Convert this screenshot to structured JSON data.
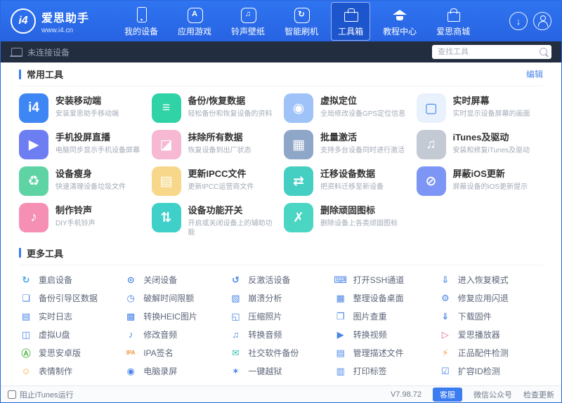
{
  "header": {
    "logo_text": "i4",
    "brand": "爱思助手",
    "website": "www.i4.cn",
    "nav": [
      {
        "label": "我的设备",
        "icon": "phone"
      },
      {
        "label": "应用游戏",
        "icon": "apps"
      },
      {
        "label": "铃声壁纸",
        "icon": "ringtone"
      },
      {
        "label": "智能刷机",
        "icon": "flash"
      },
      {
        "label": "工具箱",
        "icon": "toolbox",
        "active": true
      },
      {
        "label": "教程中心",
        "icon": "tutorial"
      },
      {
        "label": "爱思商城",
        "icon": "mall"
      }
    ]
  },
  "device_bar": {
    "status": "未连接设备",
    "search_placeholder": "查找工具"
  },
  "common_tools": {
    "title": "常用工具",
    "edit": "编辑",
    "cards": [
      {
        "title": "安装移动端",
        "subtitle": "安装爱思助手移动端",
        "icon": "i4-mobile",
        "glyph": "i4",
        "bg": "#3f86f5",
        "fg": "#ffffff"
      },
      {
        "title": "备份/恢复数据",
        "subtitle": "轻松备份和恢复设备的资料",
        "icon": "backup-restore",
        "glyph": "≡",
        "bg": "#2fd3a6",
        "fg": "#ffffff"
      },
      {
        "title": "虚拟定位",
        "subtitle": "全局修改设备GPS定位信息",
        "icon": "virtual-location",
        "glyph": "◉",
        "bg": "#9fc3f8",
        "fg": "#ffffff"
      },
      {
        "title": "实时屏幕",
        "subtitle": "实时显示设备屏幕的画面",
        "icon": "live-screen",
        "glyph": "▢",
        "bg": "#e9f1fd",
        "fg": "#3f86f5"
      },
      {
        "title": "手机投屏直播",
        "subtitle": "电脑同步显示手机设备屏幕",
        "icon": "screen-mirroring",
        "glyph": "▶",
        "bg": "#6d7ef2",
        "fg": "#ffffff"
      },
      {
        "title": "抹除所有数据",
        "subtitle": "恢复设备到出厂状态",
        "icon": "erase-all-data",
        "glyph": "◪",
        "bg": "#f6b8d2",
        "fg": "#ffffff"
      },
      {
        "title": "批量激活",
        "subtitle": "支持多台设备同时进行激活",
        "icon": "batch-activation",
        "glyph": "▦",
        "bg": "#8ea6c8",
        "fg": "#ffffff"
      },
      {
        "title": "iTunes及驱动",
        "subtitle": "安装和修复iTunes及驱动",
        "icon": "itunes-driver",
        "glyph": "♫",
        "bg": "#c3cad4",
        "fg": "#ffffff"
      },
      {
        "title": "设备瘦身",
        "subtitle": "快速清理设备垃圾文件",
        "icon": "device-cleanup",
        "glyph": "♻",
        "bg": "#5ed3a4",
        "fg": "#ffffff"
      },
      {
        "title": "更新IPCC文件",
        "subtitle": "更新IPCC运营商文件",
        "icon": "ipcc-update",
        "glyph": "▤",
        "bg": "#f7d88b",
        "fg": "#ffffff"
      },
      {
        "title": "迁移设备数据",
        "subtitle": "把资料迁移至新设备",
        "icon": "migrate-device-data",
        "glyph": "⇄",
        "bg": "#45cfc3",
        "fg": "#ffffff"
      },
      {
        "title": "屏蔽iOS更新",
        "subtitle": "屏蔽设备的iOS更新提示",
        "icon": "block-ios-update",
        "glyph": "⊘",
        "bg": "#7d96f5",
        "fg": "#ffffff"
      },
      {
        "title": "制作铃声",
        "subtitle": "DIY手机铃声",
        "icon": "ringtone-maker",
        "glyph": "♪",
        "bg": "#f590b4",
        "fg": "#ffffff"
      },
      {
        "title": "设备功能开关",
        "subtitle": "开启或关闭设备上的辅助功能",
        "icon": "device-switches",
        "glyph": "⇅",
        "bg": "#3fd0c9",
        "fg": "#ffffff"
      },
      {
        "title": "删除顽固图标",
        "subtitle": "删除设备上各类顽固图标",
        "icon": "delete-stubborn-icons",
        "glyph": "✗",
        "bg": "#4ad6c2",
        "fg": "#ffffff"
      }
    ]
  },
  "more_tools": {
    "title": "更多工具",
    "items": [
      {
        "label": "重启设备",
        "icon": "restart-device",
        "glyph": "↻",
        "color": "#49a6e8"
      },
      {
        "label": "关闭设备",
        "icon": "shutdown-device",
        "glyph": "⊙",
        "color": "#4a86e8"
      },
      {
        "label": "反激活设备",
        "icon": "deactivate-device",
        "glyph": "↺",
        "color": "#4a86e8"
      },
      {
        "label": "打开SSH通道",
        "icon": "ssh-tunnel",
        "glyph": "⌨",
        "color": "#4a86e8"
      },
      {
        "label": "进入恢复模式",
        "icon": "recovery-mode",
        "glyph": "⇩",
        "color": "#4a86e8"
      },
      {
        "label": "备份引导区数据",
        "icon": "backup-boot-data",
        "glyph": "❏",
        "color": "#4a86e8"
      },
      {
        "label": "破解时间限额",
        "icon": "crack-screen-time",
        "glyph": "◷",
        "color": "#4a86e8"
      },
      {
        "label": "崩溃分析",
        "icon": "crash-analysis",
        "glyph": "▧",
        "color": "#4a86e8"
      },
      {
        "label": "整理设备桌面",
        "icon": "arrange-desktop",
        "glyph": "▦",
        "color": "#4a86e8"
      },
      {
        "label": "修复应用闪退",
        "icon": "fix-app-crash",
        "glyph": "⚙",
        "color": "#4a86e8"
      },
      {
        "label": "实时日志",
        "icon": "realtime-log",
        "glyph": "▤",
        "color": "#4a86e8"
      },
      {
        "label": "转换HEIC图片",
        "icon": "heic-converter",
        "glyph": "▩",
        "color": "#4a86e8"
      },
      {
        "label": "压缩照片",
        "icon": "compress-photos",
        "glyph": "◱",
        "color": "#4a86e8"
      },
      {
        "label": "图片查重",
        "icon": "duplicate-photo-finder",
        "glyph": "❐",
        "color": "#4a86e8"
      },
      {
        "label": "下载固件",
        "icon": "download-firmware",
        "glyph": "⇓",
        "color": "#4a86e8"
      },
      {
        "label": "虚拟U盘",
        "icon": "virtual-usb-disk",
        "glyph": "◫",
        "color": "#4a86e8"
      },
      {
        "label": "修改音频",
        "icon": "edit-audio",
        "glyph": "♪",
        "color": "#4a86e8"
      },
      {
        "label": "转换音频",
        "icon": "convert-audio",
        "glyph": "♫",
        "color": "#4a86e8"
      },
      {
        "label": "转换视频",
        "icon": "convert-video",
        "glyph": "▶",
        "color": "#4a86e8"
      },
      {
        "label": "爱思播放器",
        "icon": "i4-player",
        "glyph": "▷",
        "color": "#e2679a"
      },
      {
        "label": "爱思安卓版",
        "icon": "i4-android",
        "glyph": "Ⓐ",
        "color": "#57b94c"
      },
      {
        "label": "IPA签名",
        "icon": "ipa-signer",
        "glyph": "IPA",
        "color": "#f0923f",
        "size": "8px"
      },
      {
        "label": "社交软件备份",
        "icon": "social-app-backup",
        "glyph": "✉",
        "color": "#3fc3b6"
      },
      {
        "label": "管理描述文件",
        "icon": "manage-profiles",
        "glyph": "▤",
        "color": "#4a86e8"
      },
      {
        "label": "正品配件检测",
        "icon": "accessory-check",
        "glyph": "⚡",
        "color": "#f0a23f"
      },
      {
        "label": "表情制作",
        "icon": "emoji-maker",
        "glyph": "☺",
        "color": "#f0b23f"
      },
      {
        "label": "电脑录屏",
        "icon": "screen-recorder",
        "glyph": "◉",
        "color": "#4a86e8"
      },
      {
        "label": "一键越狱",
        "icon": "one-click-jailbreak",
        "glyph": "✶",
        "color": "#4a86e8"
      },
      {
        "label": "打印标签",
        "icon": "print-label",
        "glyph": "▥",
        "color": "#4a86e8"
      },
      {
        "label": "扩容ID检测",
        "icon": "id-check",
        "glyph": "☑",
        "color": "#4a86e8"
      }
    ]
  },
  "status_bar": {
    "block_itunes": "阻止iTunes运行",
    "version": "V7.98.72",
    "support": "客服",
    "wechat": "微信公众号",
    "check_update": "检查更新"
  }
}
